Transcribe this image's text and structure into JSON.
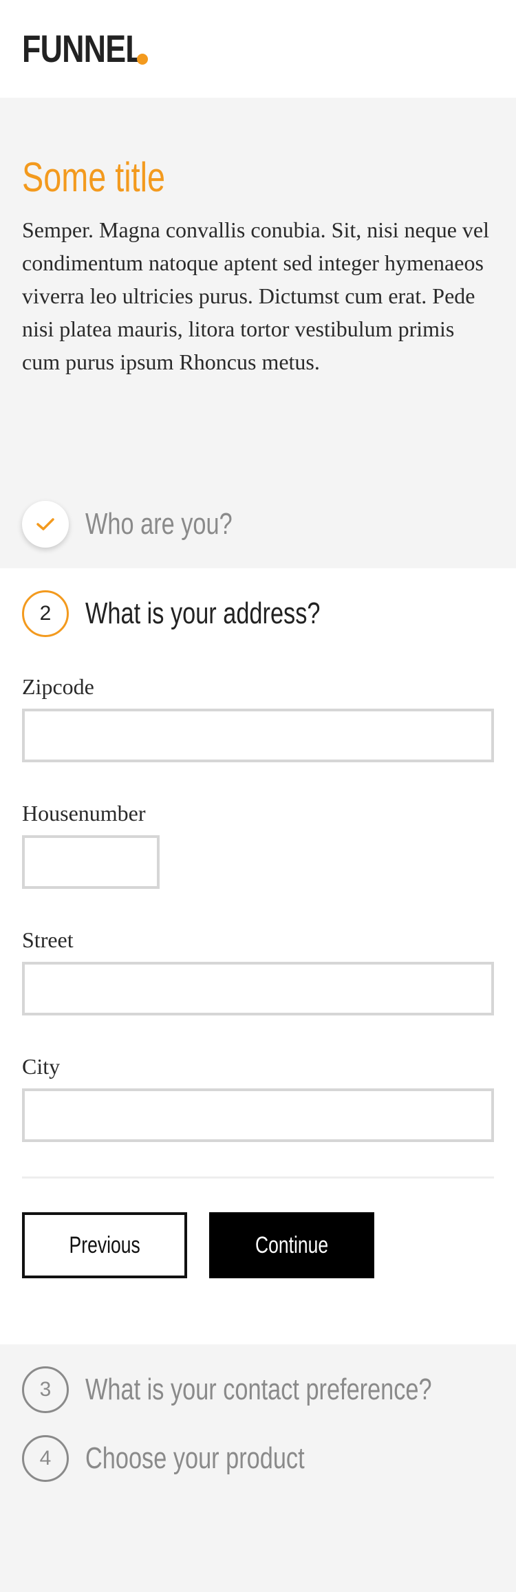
{
  "brand": {
    "name": "FUNNEL",
    "accent_color": "#f39a1e"
  },
  "intro": {
    "title": "Some title",
    "text": "Semper. Magna convallis conubia. Sit, nisi neque vel condimentum natoque aptent sed integer hymenaeos viverra leo ultricies purus. Dictumst cum erat. Pede nisi platea mauris, litora tortor vestibulum primis cum purus ipsum Rhoncus metus."
  },
  "steps": [
    {
      "number": "",
      "icon": "checkmark-icon",
      "label": "Who are you?",
      "status": "completed"
    },
    {
      "number": "2",
      "label": "What is your address?",
      "status": "active"
    },
    {
      "number": "3",
      "label": "What is your contact preference?",
      "status": "upcoming"
    },
    {
      "number": "4",
      "label": "Choose your product",
      "status": "upcoming"
    }
  ],
  "form": {
    "fields": [
      {
        "label": "Zipcode",
        "value": ""
      },
      {
        "label": "Housenumber",
        "value": ""
      },
      {
        "label": "Street",
        "value": ""
      },
      {
        "label": "City",
        "value": ""
      }
    ],
    "previous_label": "Previous",
    "continue_label": "Continue"
  }
}
